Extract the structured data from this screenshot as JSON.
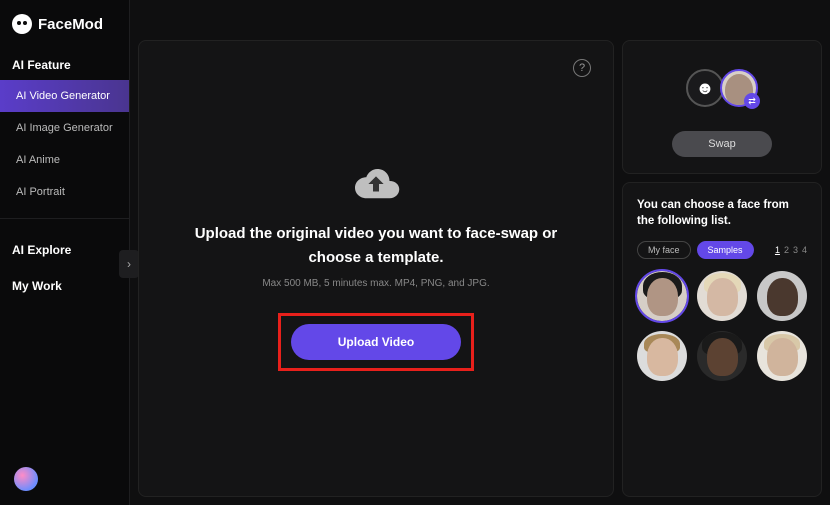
{
  "logo": "FaceMod",
  "sidebar": {
    "sections": {
      "feature": {
        "title": "AI Feature"
      },
      "explore": {
        "title": "AI Explore"
      },
      "work": {
        "title": "My Work"
      }
    },
    "items": [
      {
        "label": "AI Video Generator"
      },
      {
        "label": "AI Image Generator"
      },
      {
        "label": "AI Anime"
      },
      {
        "label": "AI Portrait"
      }
    ]
  },
  "upload": {
    "title": "Upload the original video you want to face-swap or choose a template.",
    "hint": "Max 500 MB, 5 minutes max. MP4, PNG, and JPG.",
    "button": "Upload Video"
  },
  "swap": {
    "button": "Swap"
  },
  "faces": {
    "title": "You can choose a face from the following list.",
    "tabs": {
      "myface": "My face",
      "samples": "Samples"
    },
    "pages": [
      "1",
      "2",
      "3",
      "4"
    ]
  }
}
